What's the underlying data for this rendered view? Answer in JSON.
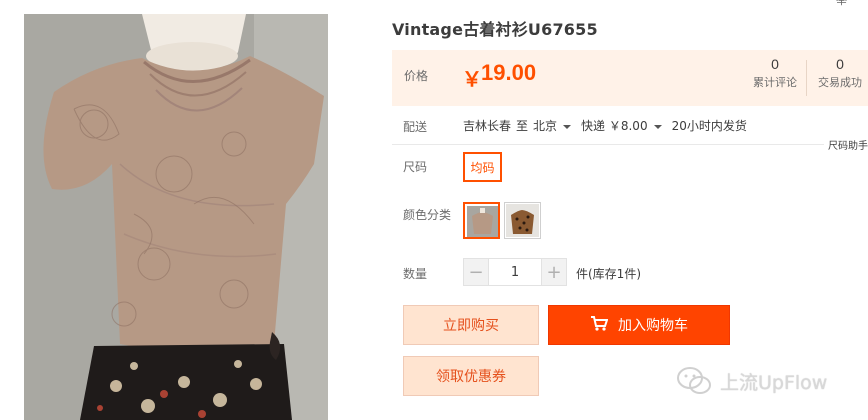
{
  "product": {
    "title": "Vintage古着衬衫U67655",
    "image_alt": "product-photo"
  },
  "top_corner": {
    "text": "举"
  },
  "price": {
    "label": "价格",
    "currency": "￥",
    "value": "19.00",
    "stats": [
      {
        "count": "0",
        "label": "累计评论"
      },
      {
        "count": "0",
        "label": "交易成功"
      }
    ]
  },
  "delivery": {
    "label": "配送",
    "from": "吉林长春",
    "to_word": "至",
    "destination": "北京",
    "shipping": "快递 ￥8.00",
    "dispatch": "20小时内发货"
  },
  "size_help": "尺码助手",
  "size": {
    "label": "尺码",
    "options": [
      "均码"
    ],
    "selected": "均码"
  },
  "color": {
    "label": "颜色分类",
    "swatches": [
      "swatch-tan-top",
      "swatch-leopard-top"
    ],
    "selected_index": 0
  },
  "quantity": {
    "label": "数量",
    "value": "1",
    "minus": "−",
    "plus": "+",
    "stock_note": "件(库存1件)"
  },
  "actions": {
    "buy_now": "立即购买",
    "add_to_cart": "加入购物车",
    "get_coupon": "领取优惠券"
  },
  "watermark": {
    "text": "上流UpFlow"
  },
  "colors": {
    "accent": "#ff5000",
    "cart_button": "#ff4400",
    "price_panel_bg": "#fff2e8",
    "light_button_bg": "#ffe4d0"
  }
}
